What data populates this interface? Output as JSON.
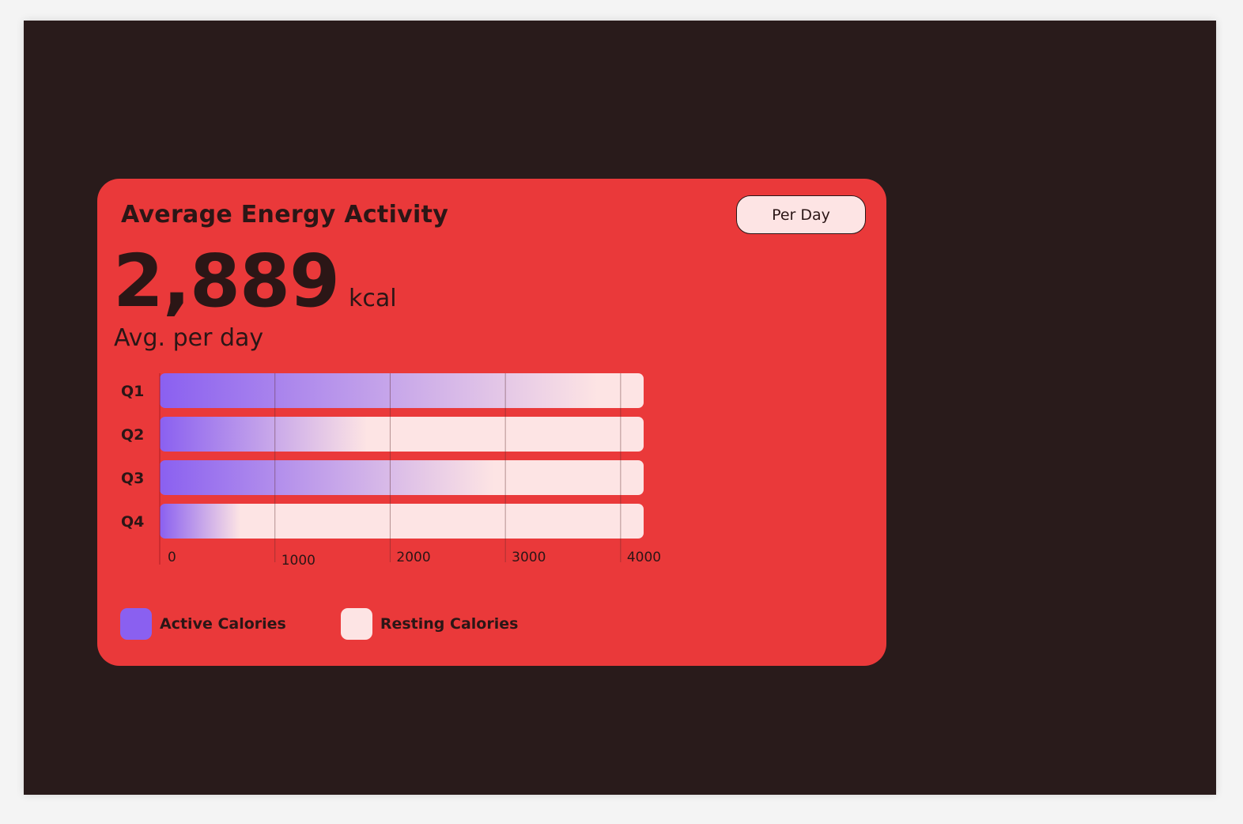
{
  "card": {
    "title": "Average Energy Activity",
    "period_button": "Per Day",
    "metric_value": "2,889",
    "metric_unit": "kcal",
    "metric_caption": "Avg. per day"
  },
  "colors": {
    "card_background": "#ea393a",
    "active": "#8a60f0",
    "resting": "#fde4e4",
    "text": "#2b1616"
  },
  "chart_data": {
    "type": "bar",
    "orientation": "horizontal",
    "stacked": true,
    "categories": [
      "Q1",
      "Q2",
      "Q3",
      "Q4"
    ],
    "series": [
      {
        "name": "Active Calories",
        "values": [
          3800,
          1800,
          2900,
          700
        ]
      },
      {
        "name": "Resting Calories",
        "values": [
          400,
          2400,
          1300,
          3500
        ]
      }
    ],
    "x_ticks": [
      "0",
      "1000",
      "2000",
      "3000",
      "4000"
    ],
    "xlim": [
      0,
      4200
    ],
    "grid": true,
    "legend_position": "bottom-left"
  },
  "legend": [
    {
      "label": "Active Calories",
      "color": "#8a60f0"
    },
    {
      "label": "Resting Calories",
      "color": "#fde4e4"
    }
  ]
}
